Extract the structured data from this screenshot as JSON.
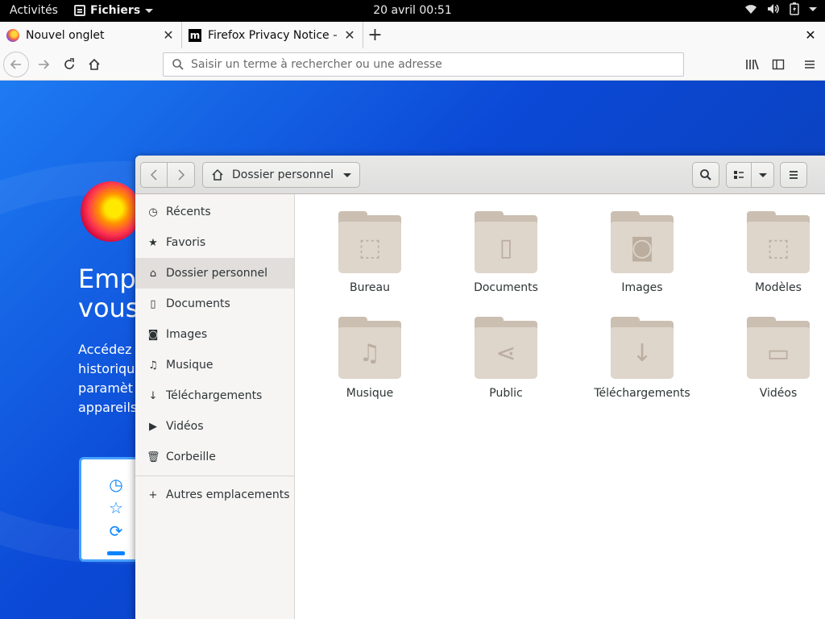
{
  "topbar": {
    "activities": "Activités",
    "app_menu": "Fichiers",
    "clock": "20 avril  00:51"
  },
  "firefox": {
    "tabs": [
      {
        "title": "Nouvel onglet",
        "active": true
      },
      {
        "title": "Firefox Privacy Notice —",
        "active": false
      }
    ],
    "url_placeholder": "Saisir un terme à rechercher ou une adresse",
    "page": {
      "title_line1": "Emp",
      "title_line2": "vous",
      "desc_lines": [
        "Accédez",
        "historiqu",
        "paramèt",
        "appareils"
      ]
    }
  },
  "nautilus": {
    "path_label": "Dossier personnel",
    "sidebar": {
      "items": [
        {
          "label": "Récents",
          "icon": "clock-icon"
        },
        {
          "label": "Favoris",
          "icon": "star-icon"
        },
        {
          "label": "Dossier personnel",
          "icon": "home-icon",
          "selected": true
        },
        {
          "label": "Documents",
          "icon": "document-icon"
        },
        {
          "label": "Images",
          "icon": "camera-icon"
        },
        {
          "label": "Musique",
          "icon": "music-icon"
        },
        {
          "label": "Téléchargements",
          "icon": "download-icon"
        },
        {
          "label": "Vidéos",
          "icon": "video-icon"
        },
        {
          "label": "Corbeille",
          "icon": "trash-icon"
        }
      ],
      "other": {
        "label": "Autres emplacements",
        "icon": "plus-icon"
      }
    },
    "folders": [
      {
        "label": "Bureau",
        "emblem": "desktop-icon"
      },
      {
        "label": "Documents",
        "emblem": "document-icon"
      },
      {
        "label": "Images",
        "emblem": "camera-icon"
      },
      {
        "label": "Modèles",
        "emblem": "template-icon"
      },
      {
        "label": "Musique",
        "emblem": "music-icon"
      },
      {
        "label": "Public",
        "emblem": "share-icon"
      },
      {
        "label": "Téléchargements",
        "emblem": "download-icon"
      },
      {
        "label": "Vidéos",
        "emblem": "video-icon"
      }
    ]
  }
}
